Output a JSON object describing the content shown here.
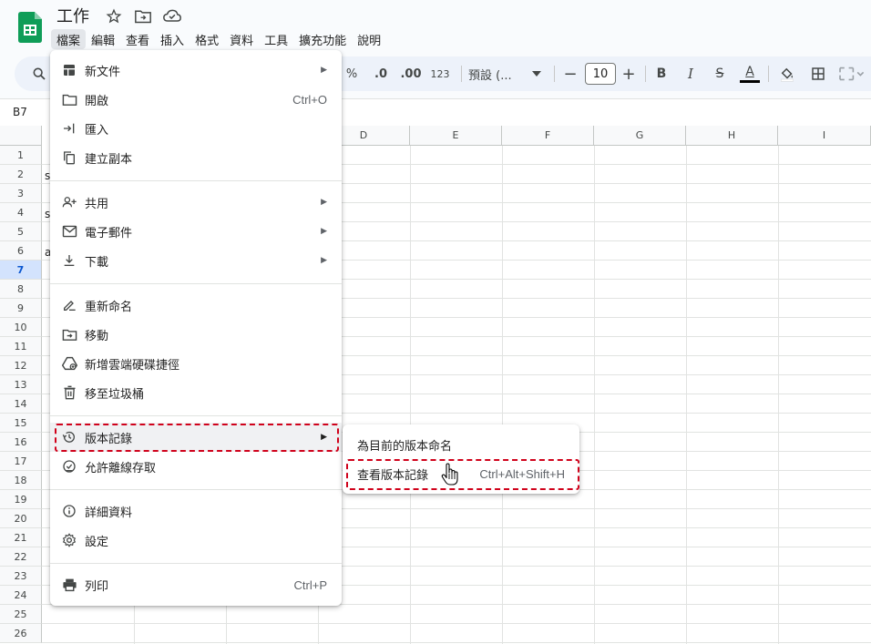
{
  "title": "工作",
  "menubar": [
    "檔案",
    "編輯",
    "查看",
    "插入",
    "格式",
    "資料",
    "工具",
    "擴充功能",
    "說明"
  ],
  "toolbar": {
    "percent": "%",
    "decrease_decimal": ".0",
    "increase_decimal": ".00",
    "number_format": "123",
    "font": "預設 (...",
    "font_size": "10",
    "minus": "−",
    "plus": "+",
    "bold": "B",
    "italic": "I",
    "strike": "S",
    "text_color": "A"
  },
  "name_box": "B7",
  "columns": [
    "D",
    "E",
    "F",
    "G",
    "H",
    "I"
  ],
  "rows": [
    "1",
    "2",
    "3",
    "4",
    "5",
    "6",
    "7",
    "8",
    "9",
    "10",
    "11",
    "12",
    "13",
    "14",
    "15",
    "16",
    "17",
    "18",
    "19",
    "20",
    "21",
    "22",
    "23",
    "24",
    "25",
    "26"
  ],
  "active_row": "7",
  "cells": {
    "r2": "s",
    "r4": "s",
    "r6": "a"
  },
  "file_menu": {
    "new": "新文件",
    "open": "開啟",
    "open_shortcut": "Ctrl+O",
    "import": "匯入",
    "copy": "建立副本",
    "share": "共用",
    "email": "電子郵件",
    "download": "下載",
    "rename": "重新命名",
    "move": "移動",
    "add_shortcut": "新增雲端硬碟捷徑",
    "trash": "移至垃圾桶",
    "version_history": "版本記錄",
    "offline": "允許離線存取",
    "details": "詳細資料",
    "settings": "設定",
    "print": "列印",
    "print_shortcut": "Ctrl+P"
  },
  "version_submenu": {
    "name_current": "為目前的版本命名",
    "see_history": "查看版本記錄",
    "see_history_shortcut": "Ctrl+Alt+Shift+H"
  },
  "colors": {
    "highlight": "#d0021b",
    "sheets_green": "#0f9d58",
    "active_row": "#d3e3fd"
  }
}
